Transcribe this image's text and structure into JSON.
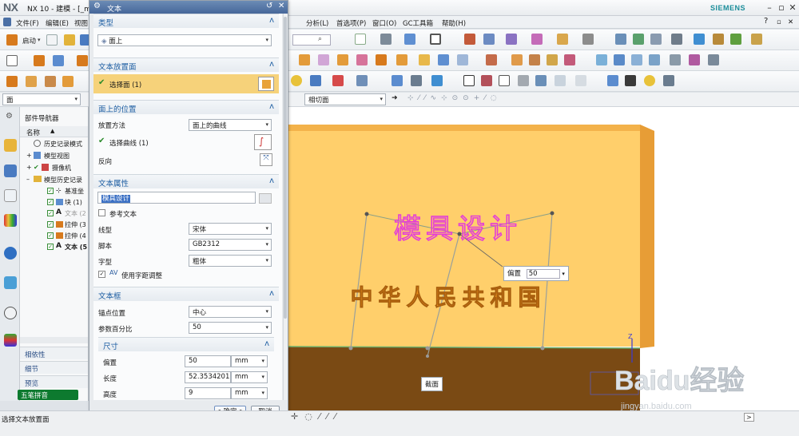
{
  "app": {
    "logo": "NX",
    "title": "NX 10 - 建模 - [_m",
    "brand": "SIEMENS"
  },
  "menubar": {
    "file_label": "文件(F)",
    "edit_label": "编辑(E)",
    "view_label": "视图",
    "analysis_label": "分析(L)",
    "prefs_label": "首选项(P)",
    "window_label": "窗口(O)",
    "gc_label": "GC工具箱",
    "help_label": "帮助(H)",
    "start_label": "启动"
  },
  "filterbar": {
    "type_filter": "面",
    "snap_mode": "相切面"
  },
  "navigator": {
    "title": "部件导航器",
    "col_name": "名称",
    "items": [
      {
        "label": "历史记录模式"
      },
      {
        "label": "模型视图"
      },
      {
        "label": "摄像机"
      },
      {
        "label": "模型历史记录"
      },
      {
        "label": "基准坐"
      },
      {
        "label": "块 (1)"
      },
      {
        "label": "文本 (2"
      },
      {
        "label": "拉伸 (3"
      },
      {
        "label": "拉伸 (4"
      },
      {
        "label": "文本 (5"
      }
    ],
    "sections": {
      "dependencies": "相依性",
      "details": "细节",
      "preview": "预览"
    },
    "ime_label": "五笔拼音"
  },
  "dialog": {
    "title": "文本",
    "type": {
      "header": "类型",
      "value": "面上"
    },
    "placement_face": {
      "header": "文本放置面",
      "select_label": "选择面 (1)"
    },
    "position_on_face": {
      "header": "面上的位置",
      "method_label": "放置方法",
      "method_value": "面上的曲线",
      "select_curve_label": "选择曲线 (1)",
      "reverse_label": "反向"
    },
    "text_attributes": {
      "header": "文本属性",
      "text_value": "模具设计",
      "ref_text_label": "参考文本",
      "linetype_label": "线型",
      "linetype_value": "宋体",
      "script_label": "脚本",
      "script_value": "GB2312",
      "fontstyle_label": "字型",
      "fontstyle_value": "粗体",
      "kerning_label": "使用字距调整"
    },
    "text_box": {
      "header": "文本框",
      "anchor_label": "锚点位置",
      "anchor_value": "中心",
      "param_pct_label": "参数百分比",
      "param_pct_value": "50"
    },
    "dimensions": {
      "header": "尺寸",
      "offset_label": "偏置",
      "offset_value": "50",
      "length_label": "长度",
      "length_value": "52.35342019",
      "height_label": "高度",
      "height_value": "9",
      "unit": "mm"
    },
    "ok_label": "< 确定 >",
    "cancel_label": "取消"
  },
  "viewport": {
    "emboss_text_main": "模具设计",
    "emboss_text_secondary": "中华人民共和国",
    "offset_tip_label": "偏置",
    "offset_tip_value": "50",
    "section_tip_label": "截面"
  },
  "status": {
    "prompt": "选择文本放置面"
  },
  "watermark": {
    "brand": "Baidu经验",
    "url": "jingyan.baidu.com"
  },
  "colors": {
    "dialog_header_text": "#1f5fa3",
    "selection_highlight": "#f6d27a",
    "block_face": "#ffcf6b",
    "block_dark": "#7a4a14",
    "magenta_text": "#e43fd6",
    "orange_text": "#e58c1a"
  }
}
